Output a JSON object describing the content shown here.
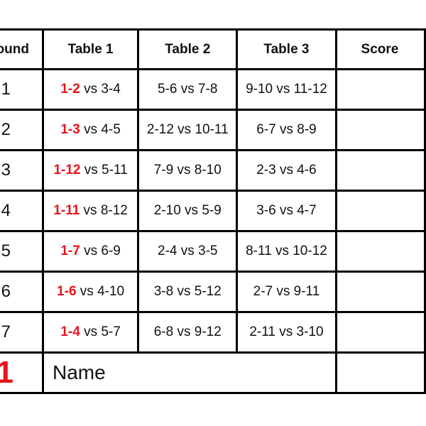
{
  "header": {
    "round": "Round",
    "table1": "Table 1",
    "table2": "Table 2",
    "table3": "Table 3",
    "score": "Score"
  },
  "rows": [
    {
      "round": "1",
      "t1_lead": "1-2",
      "t1_rest": " vs 3-4",
      "t2": "5-6 vs 7-8",
      "t3": "9-10 vs 11-12",
      "score": ""
    },
    {
      "round": "2",
      "t1_lead": "1-3",
      "t1_rest": " vs 4-5",
      "t2": "2-12 vs 10-11",
      "t3": "6-7 vs 8-9",
      "score": ""
    },
    {
      "round": "3",
      "t1_lead": "1-12",
      "t1_rest": " vs 5-11",
      "t2": "7-9 vs 8-10",
      "t3": "2-3 vs 4-6",
      "score": ""
    },
    {
      "round": "4",
      "t1_lead": "1-11",
      "t1_rest": " vs 8-12",
      "t2": "2-10 vs 5-9",
      "t3": "3-6 vs 4-7",
      "score": ""
    },
    {
      "round": "5",
      "t1_lead": "1-7",
      "t1_rest": " vs 6-9",
      "t2": "2-4 vs 3-5",
      "t3": "8-11 vs 10-12",
      "score": ""
    },
    {
      "round": "6",
      "t1_lead": "1-6",
      "t1_rest": " vs 4-10",
      "t2": "3-8 vs 5-12",
      "t3": "2-7 vs 9-11",
      "score": ""
    },
    {
      "round": "7",
      "t1_lead": "1-4",
      "t1_rest": " vs 5-7",
      "t2": "6-8  vs 9-12",
      "t3": "2-11 vs 3-10",
      "score": ""
    }
  ],
  "footer": {
    "player_number": "1",
    "name_label": "Name"
  },
  "colors": {
    "highlight": "#e8141b",
    "border": "#000000"
  }
}
